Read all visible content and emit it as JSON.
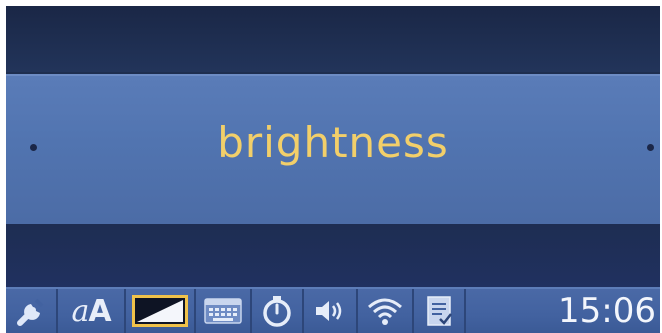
{
  "menu": {
    "title": "brightness"
  },
  "status_bar": {
    "icons": [
      {
        "name": "wrench-icon",
        "selected": false
      },
      {
        "name": "font-size-icon",
        "label_small": "a",
        "label_large": "A",
        "selected": false
      },
      {
        "name": "brightness-icon",
        "selected": true
      },
      {
        "name": "keyboard-icon",
        "selected": false
      },
      {
        "name": "timer-icon",
        "selected": false
      },
      {
        "name": "volume-icon",
        "selected": false
      },
      {
        "name": "wifi-icon",
        "selected": false
      },
      {
        "name": "document-icon",
        "selected": false
      }
    ],
    "time": "15:06"
  },
  "colors": {
    "highlight_text": "#f2cf6a",
    "selection_border": "#f0c24a",
    "band": "#5174b0",
    "background": "#1c2a4a"
  }
}
